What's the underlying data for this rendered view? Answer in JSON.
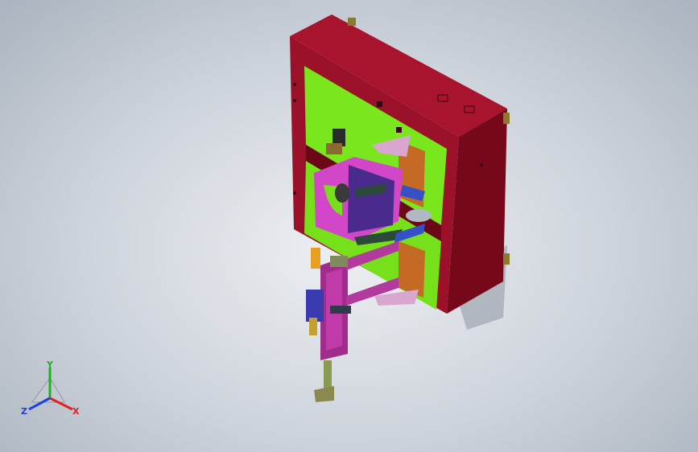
{
  "colors": {
    "background": "#c7cdd6",
    "frame": "#8b0f24",
    "panel": "#7ae61e",
    "magenta": "#d247c8",
    "purple": "#4a2a8c",
    "orange": "#c46a25",
    "axis_x": "#e02020",
    "axis_y": "#20b020",
    "axis_z": "#2040e0"
  },
  "icons": {
    "triad": "coordinate-triad-icon",
    "model": "cad-assembly"
  },
  "triad": {
    "x_label": "X",
    "y_label": "Y",
    "z_label": "Z"
  }
}
